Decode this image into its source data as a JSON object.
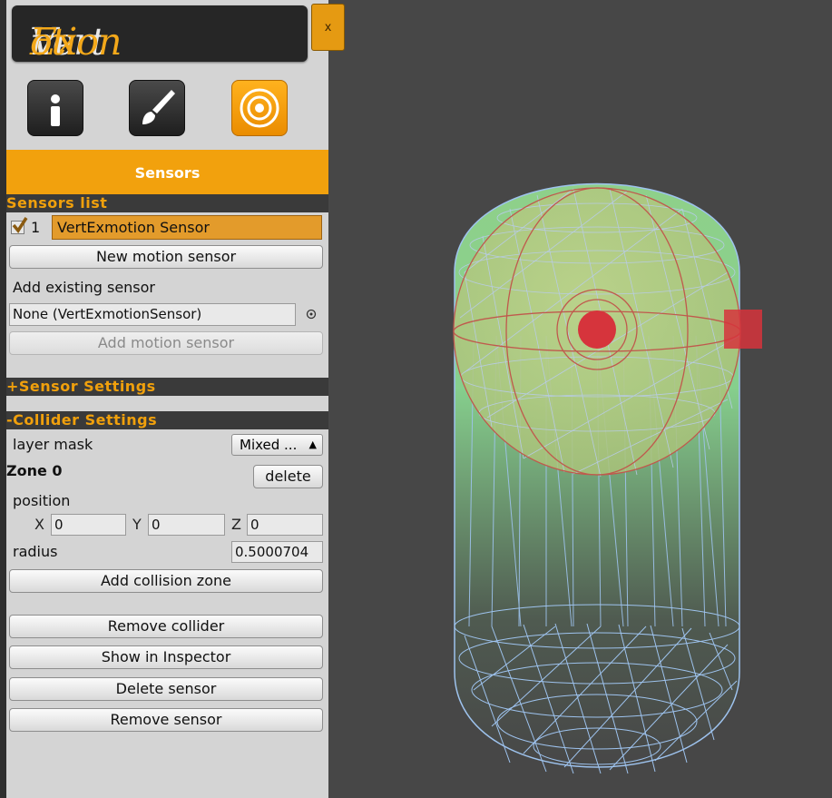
{
  "header": {
    "logo_text": {
      "part1": "Vert",
      "part2": "Ex",
      "part3": "m",
      "part4": "otion"
    },
    "close_label": "x"
  },
  "tool_icons": [
    {
      "name": "info-icon"
    },
    {
      "name": "brush-icon"
    },
    {
      "name": "sensor-icon"
    }
  ],
  "tab": {
    "label": "Sensors"
  },
  "sensors_list": {
    "header": "Sensors list",
    "items": [
      {
        "index": "1",
        "name": "VertExmotion Sensor",
        "checked": true
      }
    ],
    "new_sensor_button": "New motion sensor",
    "add_existing_label": "Add existing sensor",
    "existing_field_value": "None (VertExmotionSensor)",
    "add_sensor_button": "Add motion sensor"
  },
  "sensor_settings": {
    "header": "+Sensor Settings"
  },
  "collider_settings": {
    "header": "-Collider Settings",
    "layer_mask_label": "layer mask",
    "layer_mask_value": "Mixed ...",
    "zone_label": "Zone 0",
    "delete_button": "delete",
    "position_label": "position",
    "x_label": "X",
    "x_value": "0",
    "y_label": "Y",
    "y_value": "0",
    "z_label": "Z",
    "z_value": "0",
    "radius_label": "radius",
    "radius_value": "0.5000704",
    "add_zone_button": "Add collision zone"
  },
  "actions": {
    "remove_collider": "Remove collider",
    "show_inspector": "Show in Inspector",
    "delete_sensor": "Delete sensor",
    "remove_sensor": "Remove sensor"
  },
  "colors": {
    "accent": "#f2a10d",
    "panel_bg": "#d4d4d4",
    "section_header_bg": "#3a3a3a",
    "viewport_bg": "#474747",
    "selected_row": "#e39b2b"
  }
}
